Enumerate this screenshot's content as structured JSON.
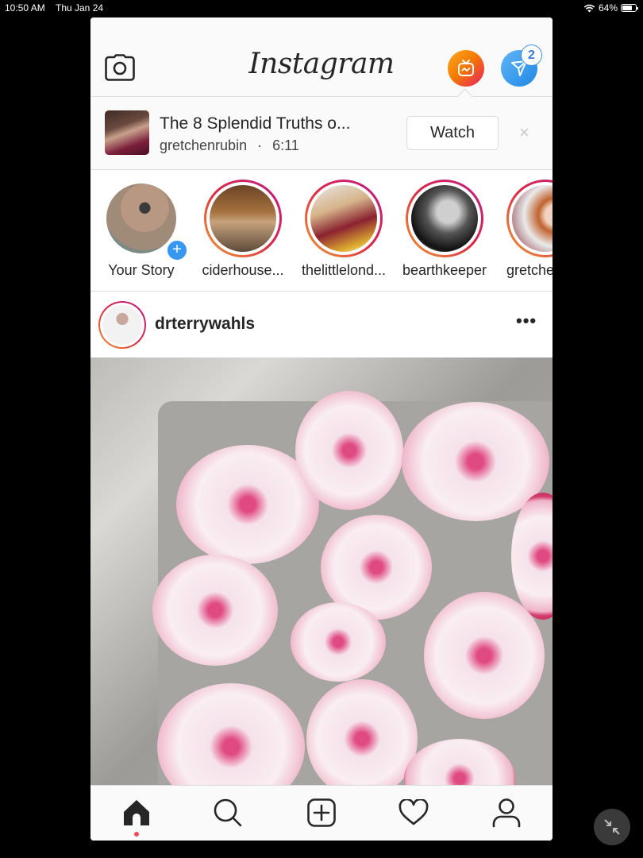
{
  "status_bar": {
    "time": "10:50 AM",
    "date": "Thu Jan 24",
    "battery_percent": "64%",
    "battery_level": 0.64,
    "icons": [
      "wifi-icon",
      "battery-icon"
    ]
  },
  "header": {
    "logo": "Instagram",
    "camera_icon": "camera-icon",
    "igtv_icon": "igtv-icon",
    "direct_icon": "direct-message-icon",
    "direct_badge_count": "2"
  },
  "igtv_banner": {
    "title": "The 8 Splendid Truths o...",
    "channel": "gretchenrubin",
    "separator": "·",
    "duration": "6:11",
    "watch_label": "Watch",
    "dismiss_label": "×"
  },
  "stories": [
    {
      "username": "Your Story",
      "is_own": true
    },
    {
      "username": "ciderhouse..."
    },
    {
      "username": "thelittlelond..."
    },
    {
      "username": "bearthkeeper"
    },
    {
      "username": "gretche"
    }
  ],
  "post": {
    "username": "drterrywahls",
    "more_label": "•••",
    "image_description": "Sliced watermelon radishes on a metal baking tray"
  },
  "tab_bar": {
    "items": [
      {
        "name": "home",
        "icon": "home-icon",
        "active": true
      },
      {
        "name": "search",
        "icon": "search-icon"
      },
      {
        "name": "new-post",
        "icon": "add-post-icon"
      },
      {
        "name": "activity",
        "icon": "heart-icon"
      },
      {
        "name": "profile",
        "icon": "profile-icon"
      }
    ]
  },
  "system": {
    "exit_fullscreen_icon": "compress-arrows-icon"
  }
}
